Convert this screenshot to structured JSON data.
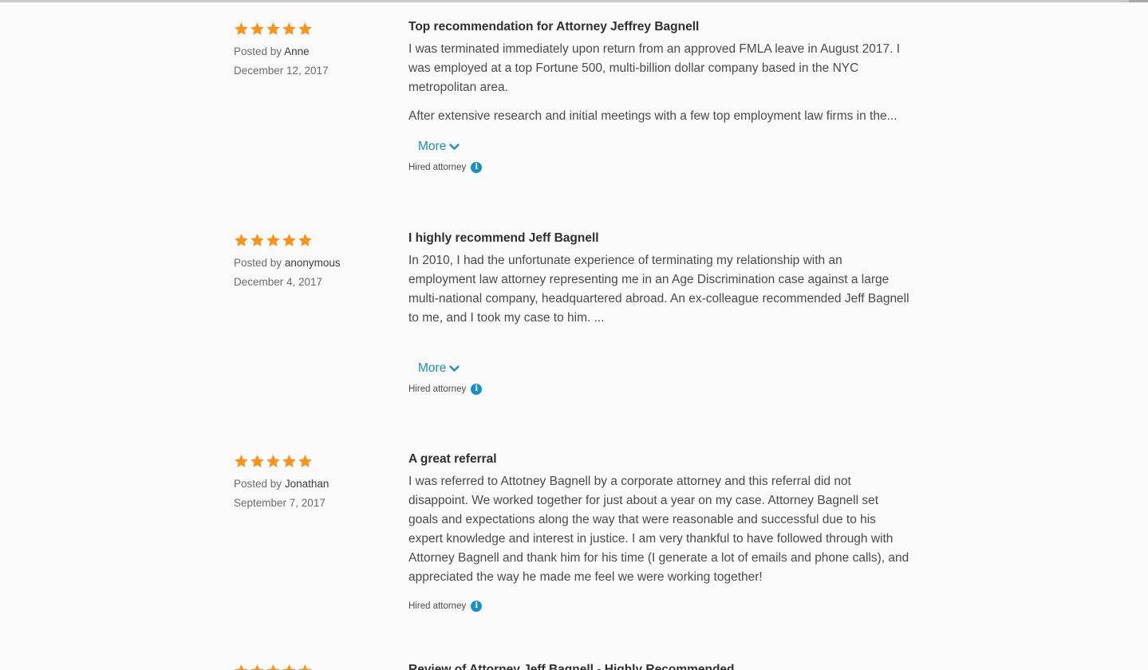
{
  "colors": {
    "star": "#f7941d",
    "link": "#1a8fc1",
    "background": "#fafafa"
  },
  "reviews": [
    {
      "rating": 5,
      "posted_by_label": "Posted by",
      "author": "Anne",
      "date": "December 12, 2017",
      "title": "Top recommendation for Attorney Jeffrey Bagnell",
      "paragraphs": [
        "I was terminated immediately upon return from an approved FMLA leave in August 2017. I was employed at a top Fortune 500, multi-billion dollar company based in the NYC metropolitan area.",
        "After extensive research and initial meetings with a few top employment law firms in the..."
      ],
      "more_label": "More",
      "hired_label": "Hired attorney",
      "info_icon": "info-icon"
    },
    {
      "rating": 5,
      "posted_by_label": "Posted by",
      "author": "anonymous",
      "date": "December 4, 2017",
      "title": "I highly recommend Jeff Bagnell",
      "paragraphs": [
        "In 2010, I had the unfortunate experience of terminating my relationship with an employment law attorney representing me in an Age Discrimination case against a large multi-national company, headquartered abroad. An ex-colleague recommended Jeff Bagnell to me, and I took my case to him. ..."
      ],
      "more_label": "More",
      "hired_label": "Hired attorney",
      "info_icon": "info-icon"
    },
    {
      "rating": 5,
      "posted_by_label": "Posted by",
      "author": "Jonathan",
      "date": "September 7, 2017",
      "title": "A great referral",
      "paragraphs": [
        "I was referred to Attotney Bagnell by a corporate attorney and this referral did not disappoint. We worked together for just about a year on my case. Attorney Bagnell set goals and expectations along the way that were reasonable and successful due to his expert knowledge and interest in justice. I am very thankful to have followed through with Attorney Bagnell and thank him for his time (I generate a lot of emails and phone calls), and appreciated the way he made me feel we were working together!"
      ],
      "hired_label": "Hired attorney",
      "info_icon": "info-icon"
    }
  ],
  "next_review_title": "Review of Attorney Jeff Bagnell - Highly Recommended"
}
